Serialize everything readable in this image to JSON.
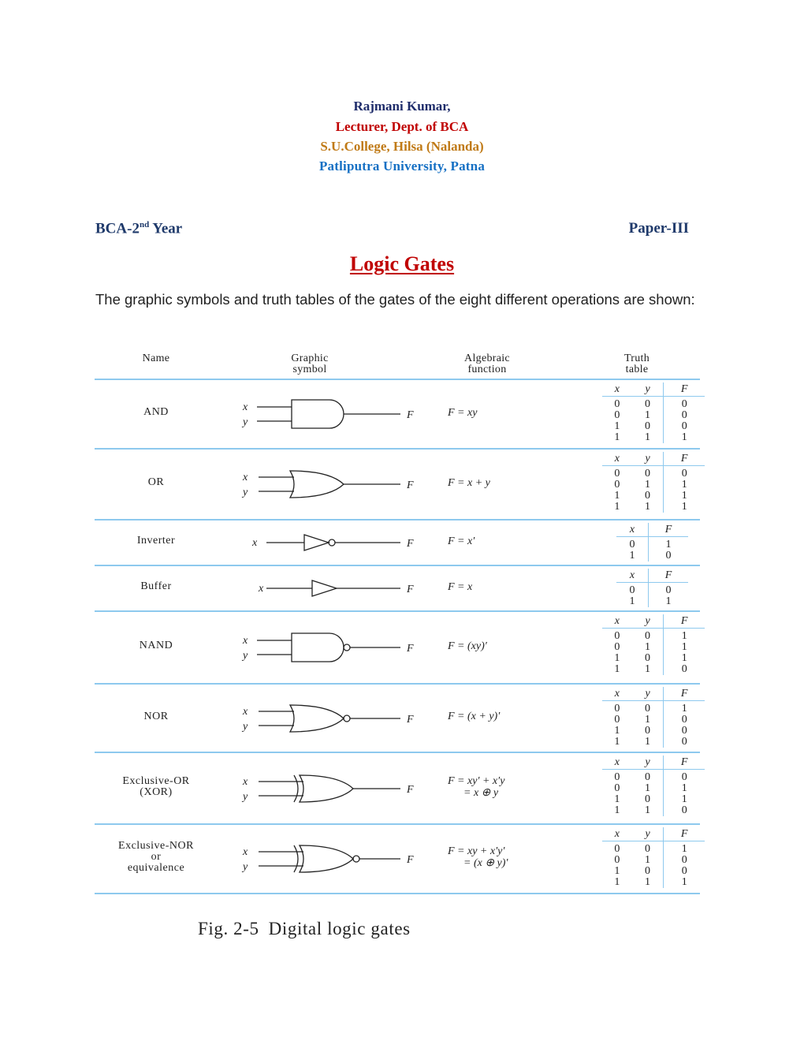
{
  "header": {
    "author": "Rajmani Kumar,",
    "role": "Lecturer, Dept. of BCA",
    "college": "S.U.College, Hilsa (Nalanda)",
    "university": "Patliputra University, Patna",
    "colors": {
      "author": "#1f2d6b",
      "role": "#c00000",
      "college": "#c07a16",
      "university": "#1670c4"
    }
  },
  "meta": {
    "course_prefix": "BCA-2",
    "course_sup": "nd",
    "course_suffix": " Year",
    "paper": "Paper-III"
  },
  "title": "Logic Gates",
  "intro": "The graphic symbols and truth tables of the gates of the eight different operations are shown:",
  "figure": {
    "columns": {
      "name": "Name",
      "symbol_1": "Graphic",
      "symbol_2": "symbol",
      "function_1": "Algebraic",
      "function_2": "function",
      "truth_1": "Truth",
      "truth_2": "table"
    },
    "rule_color": "#8ec9ee",
    "gates": [
      {
        "name": [
          "AND"
        ],
        "symbol": "and-gate",
        "inputs": [
          "x",
          "y"
        ],
        "output": "F",
        "function": [
          "F = xy"
        ],
        "truth": {
          "headers": [
            "x",
            "y",
            "F"
          ],
          "rows": [
            [
              "0",
              "0",
              "0"
            ],
            [
              "0",
              "1",
              "0"
            ],
            [
              "1",
              "0",
              "0"
            ],
            [
              "1",
              "1",
              "1"
            ]
          ]
        }
      },
      {
        "name": [
          "OR"
        ],
        "symbol": "or-gate",
        "inputs": [
          "x",
          "y"
        ],
        "output": "F",
        "function": [
          "F = x + y"
        ],
        "truth": {
          "headers": [
            "x",
            "y",
            "F"
          ],
          "rows": [
            [
              "0",
              "0",
              "0"
            ],
            [
              "0",
              "1",
              "1"
            ],
            [
              "1",
              "0",
              "1"
            ],
            [
              "1",
              "1",
              "1"
            ]
          ]
        }
      },
      {
        "name": [
          "Inverter"
        ],
        "symbol": "inverter-gate",
        "inputs": [
          "x"
        ],
        "output": "F",
        "function": [
          "F = x′"
        ],
        "truth": {
          "headers": [
            "x",
            "F"
          ],
          "rows": [
            [
              "0",
              "1"
            ],
            [
              "1",
              "0"
            ]
          ]
        }
      },
      {
        "name": [
          "Buffer"
        ],
        "symbol": "buffer-gate",
        "inputs": [
          "x"
        ],
        "output": "F",
        "function": [
          "F = x"
        ],
        "truth": {
          "headers": [
            "x",
            "F"
          ],
          "rows": [
            [
              "0",
              "0"
            ],
            [
              "1",
              "1"
            ]
          ]
        }
      },
      {
        "name": [
          "NAND"
        ],
        "symbol": "nand-gate",
        "inputs": [
          "x",
          "y"
        ],
        "output": "F",
        "function": [
          "F = (xy)′"
        ],
        "truth": {
          "headers": [
            "x",
            "y",
            "F"
          ],
          "rows": [
            [
              "0",
              "0",
              "1"
            ],
            [
              "0",
              "1",
              "1"
            ],
            [
              "1",
              "0",
              "1"
            ],
            [
              "1",
              "1",
              "0"
            ]
          ]
        }
      },
      {
        "name": [
          "NOR"
        ],
        "symbol": "nor-gate",
        "inputs": [
          "x",
          "y"
        ],
        "output": "F",
        "function": [
          "F = (x + y)′"
        ],
        "truth": {
          "headers": [
            "x",
            "y",
            "F"
          ],
          "rows": [
            [
              "0",
              "0",
              "1"
            ],
            [
              "0",
              "1",
              "0"
            ],
            [
              "1",
              "0",
              "0"
            ],
            [
              "1",
              "1",
              "0"
            ]
          ]
        }
      },
      {
        "name": [
          "Exclusive-OR",
          "(XOR)"
        ],
        "symbol": "xor-gate",
        "inputs": [
          "x",
          "y"
        ],
        "output": "F",
        "function": [
          "F = xy′ + x′y",
          "= x ⊕ y"
        ],
        "truth": {
          "headers": [
            "x",
            "y",
            "F"
          ],
          "rows": [
            [
              "0",
              "0",
              "0"
            ],
            [
              "0",
              "1",
              "1"
            ],
            [
              "1",
              "0",
              "1"
            ],
            [
              "1",
              "1",
              "0"
            ]
          ]
        }
      },
      {
        "name": [
          "Exclusive-NOR",
          "or",
          "equivalence"
        ],
        "symbol": "xnor-gate",
        "inputs": [
          "x",
          "y"
        ],
        "output": "F",
        "function": [
          "F = xy + x′y′",
          "= (x ⊕ y)′"
        ],
        "truth": {
          "headers": [
            "x",
            "y",
            "F"
          ],
          "rows": [
            [
              "0",
              "0",
              "1"
            ],
            [
              "0",
              "1",
              "0"
            ],
            [
              "1",
              "0",
              "0"
            ],
            [
              "1",
              "1",
              "1"
            ]
          ]
        }
      }
    ],
    "caption_label": "Fig. 2-5",
    "caption_text": "Digital logic gates"
  }
}
